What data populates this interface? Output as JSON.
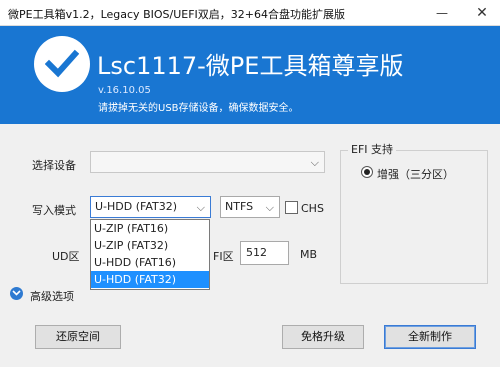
{
  "window": {
    "title": "微PE工具箱v1.2，Legacy BIOS/UEFI双启，32+64合盘功能扩展版",
    "minimize_glyph": "—",
    "close_glyph": "✕"
  },
  "header": {
    "app_name": "Lsc1117-微PE工具箱尊享版",
    "version": "v.16.10.05",
    "warning": "请拔掉无关的USB存储设备，确保数据安全。",
    "logo_icon": "checkmark-icon",
    "bg_color": "#1976d2"
  },
  "form": {
    "device_label": "选择设备",
    "device_value": "",
    "mode_label": "写入模式",
    "mode_value": "U-HDD (FAT32)",
    "mode_options": [
      "U-ZIP (FAT16)",
      "U-ZIP (FAT32)",
      "U-HDD (FAT16)",
      "U-HDD (FAT32)"
    ],
    "mode_selected_index": 3,
    "fs_value": "NTFS",
    "chs_label": "CHS",
    "chs_checked": false,
    "ud_label": "UD区",
    "efi_size_label": "FI区",
    "efi_size_value": "512",
    "unit_label": "MB",
    "advanced_label": "高级选项"
  },
  "efi_group": {
    "title": "EFI 支持",
    "option_label": "增强（三分区）",
    "option_selected": true
  },
  "buttons": {
    "restore": "还原空间",
    "upgrade": "免格升级",
    "new_install": "全新制作"
  },
  "chevron_glyph": "⌵"
}
